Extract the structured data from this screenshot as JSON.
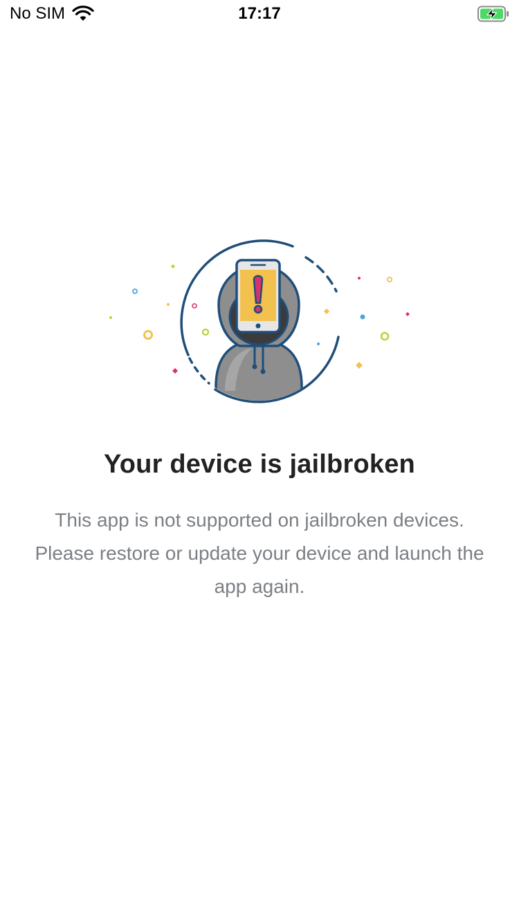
{
  "status_bar": {
    "carrier": "No SIM",
    "time": "17:17",
    "wifi_icon": "wifi-icon",
    "battery_icon": "battery-charging-icon",
    "battery_color": "#4cd964"
  },
  "illustration": {
    "icon": "hooded-hacker-with-warning-phone-icon",
    "phone_color": "#f2c14e",
    "exclamation_color": "#d6336c",
    "outline_color": "#1f4e79",
    "hoodie_color": "#8e8e8e"
  },
  "content": {
    "title": "Your device is jailbroken",
    "message": "This app is not supported on jailbroken devices. Please restore or update your device and launch the app again."
  }
}
